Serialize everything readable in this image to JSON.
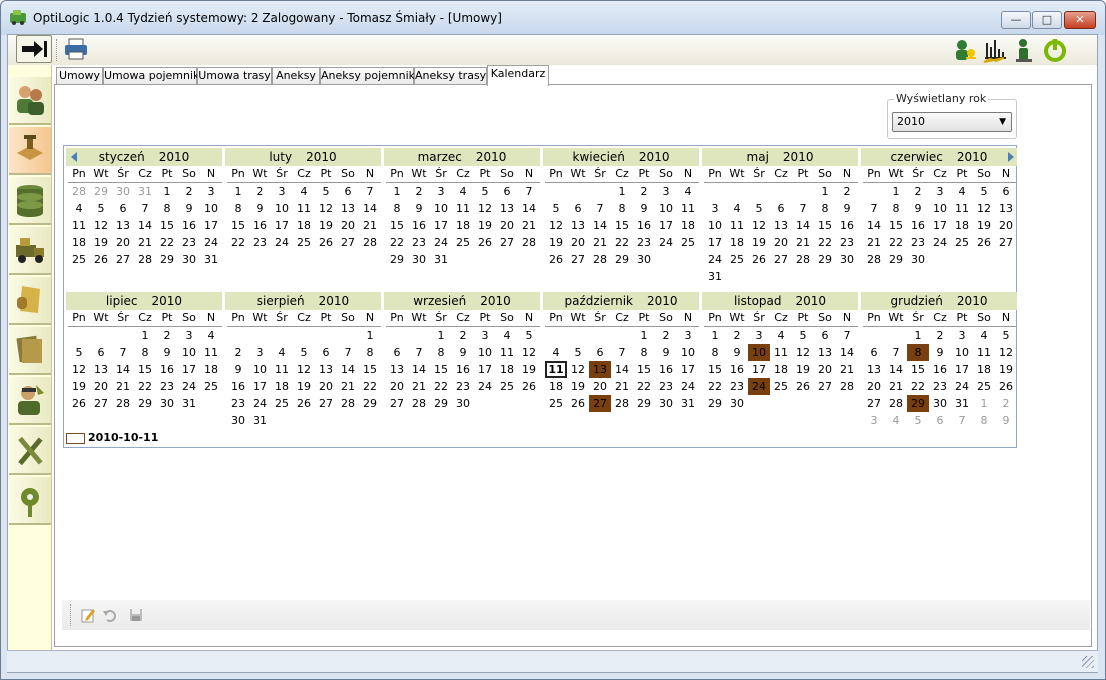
{
  "window": {
    "title": "OptiLogic 1.0.4  Tydzień systemowy: 2  Zalogowany - Tomasz Śmiały - [Umowy]",
    "min_label": "—",
    "max_label": "□",
    "close_label": "✕"
  },
  "sidebar": {
    "items": [
      {
        "icon": "users-icon"
      },
      {
        "icon": "document-stamp-icon"
      },
      {
        "icon": "database-icon"
      },
      {
        "icon": "truck-icon"
      },
      {
        "icon": "paper-hand-icon"
      },
      {
        "icon": "folders-icon"
      },
      {
        "icon": "driver-icon"
      },
      {
        "icon": "tools-icon"
      },
      {
        "icon": "settings-gear-icon"
      }
    ]
  },
  "tabs": [
    {
      "label": "Umowy"
    },
    {
      "label": "Umowa pojemniki"
    },
    {
      "label": "Umowa trasy"
    },
    {
      "label": "Aneksy"
    },
    {
      "label": "Aneksy pojemniki"
    },
    {
      "label": "Aneksy trasy"
    },
    {
      "label": "Kalendarz"
    }
  ],
  "year_selector": {
    "legend": "Wyświetlany rok",
    "value": "2010"
  },
  "calendar": {
    "year": "2010",
    "dow": [
      "Pn",
      "Wt",
      "Śr",
      "Cz",
      "Pt",
      "So",
      "N"
    ],
    "today_label": "2010-10-11",
    "highlight_color": "#7a3f0e",
    "months": [
      {
        "name": "styczeń",
        "lead": [
          28,
          29,
          30,
          31
        ],
        "days": 31,
        "trail": []
      },
      {
        "name": "luty",
        "lead": [],
        "days": 28,
        "trail": []
      },
      {
        "name": "marzec",
        "lead": [],
        "days": 31,
        "trail": []
      },
      {
        "name": "kwiecień",
        "lead": [],
        "days": 30,
        "trail": []
      },
      {
        "name": "maj",
        "lead": [],
        "days": 31,
        "trail": []
      },
      {
        "name": "czerwiec",
        "lead": [],
        "days": 30,
        "trail": []
      },
      {
        "name": "lipiec",
        "lead": [],
        "days": 31,
        "trail": []
      },
      {
        "name": "sierpień",
        "lead": [],
        "days": 31,
        "trail": []
      },
      {
        "name": "wrzesień",
        "lead": [],
        "days": 30,
        "trail": []
      },
      {
        "name": "październik",
        "lead": [],
        "days": 31,
        "trail": [],
        "highlighted": [
          13,
          27
        ],
        "today": 11
      },
      {
        "name": "listopad",
        "lead": [],
        "days": 30,
        "trail": [],
        "highlighted": [
          10,
          24
        ]
      },
      {
        "name": "grudzień",
        "lead": [],
        "days": 31,
        "trail": [
          1,
          2,
          3,
          4,
          5,
          6,
          7,
          8,
          9
        ],
        "highlighted": [
          8,
          29
        ]
      }
    ],
    "offsets": [
      4,
      0,
      0,
      3,
      5,
      1,
      3,
      6,
      2,
      4,
      0,
      2
    ]
  }
}
